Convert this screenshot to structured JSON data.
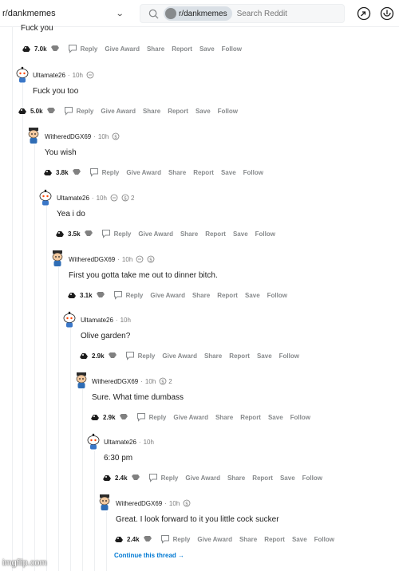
{
  "header": {
    "subreddit": "r/dankmemes",
    "search_chip": "r/dankmemes",
    "search_placeholder": "Search Reddit",
    "icons": [
      "chevron-down-icon",
      "search-icon",
      "popular-icon",
      "notification-icon"
    ]
  },
  "comments": [
    {
      "username": "",
      "time": "",
      "body": "Fuck you",
      "votes": "7.0k",
      "awards": ""
    },
    {
      "username": "Ultamate26",
      "time": "10h",
      "body": "Fuck you too",
      "votes": "5.0k",
      "awards": ""
    },
    {
      "username": "WitheredDGX69",
      "time": "10h",
      "body": "You wish",
      "votes": "3.8k",
      "awards": ""
    },
    {
      "username": "Ultamate26",
      "time": "10h",
      "body": "Yea i do",
      "votes": "3.5k",
      "awards": "2"
    },
    {
      "username": "WitheredDGX69",
      "time": "10h",
      "body": "First you gotta take me out to dinner bitch.",
      "votes": "3.1k",
      "awards": ""
    },
    {
      "username": "Ultamate26",
      "time": "10h",
      "body": "Olive garden?",
      "votes": "2.9k",
      "awards": ""
    },
    {
      "username": "WitheredDGX69",
      "time": "10h",
      "body": "Sure. What time dumbass",
      "votes": "2.9k",
      "awards": "2"
    },
    {
      "username": "Ultamate26",
      "time": "10h",
      "body": "6:30 pm",
      "votes": "2.4k",
      "awards": ""
    },
    {
      "username": "WitheredDGX69",
      "time": "10h",
      "body": "Great. I look forward to it you little cock sucker",
      "votes": "2.4k",
      "awards": ""
    }
  ],
  "actions": {
    "reply": "Reply",
    "give_award": "Give Award",
    "share": "Share",
    "report": "Report",
    "save": "Save",
    "follow": "Follow",
    "separator": "·"
  },
  "continue_thread": "Continue this thread →",
  "watermark": "imgflip.com",
  "colors": {
    "link_blue": "#0079d3",
    "meta_gray": "#7c7c7c",
    "thread_line": "#edeff1",
    "text": "#1c1c1c"
  }
}
